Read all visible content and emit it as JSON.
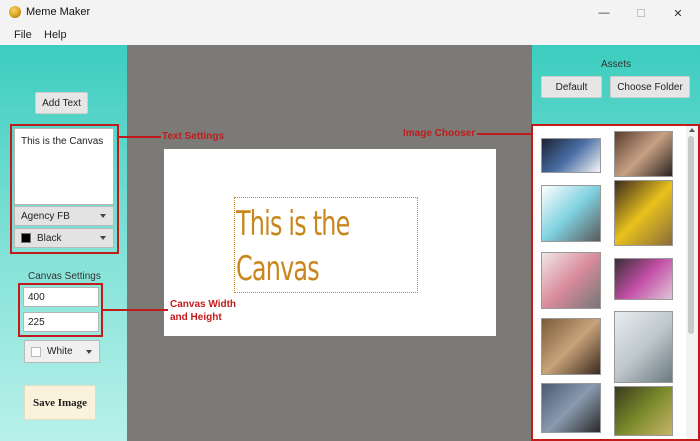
{
  "window": {
    "title": "Meme Maker",
    "minimize_glyph": "—",
    "maximize_glyph": "☐",
    "close_glyph": "✕"
  },
  "menu": {
    "items": [
      {
        "label": "File"
      },
      {
        "label": "Help"
      }
    ]
  },
  "left": {
    "add_text_label": "Add Text",
    "text_content": "This is the Canvas",
    "font_value": "Agency FB",
    "color_value": "Black",
    "color_swatch": "#000000",
    "canvas_settings_label": "Canvas Settings",
    "width_value": "400",
    "height_value": "225",
    "bg_value": "White",
    "bg_swatch": "#ffffff",
    "save_label": "Save Image"
  },
  "canvas": {
    "text_line1": "This is the",
    "text_line2": "Canvas",
    "text_color": "#c8861c"
  },
  "annotations": {
    "text_settings": "Text Settings",
    "image_chooser": "Image Chooser",
    "canvas_wh_line1": "Canvas Width",
    "canvas_wh_line2": "and Height"
  },
  "right": {
    "assets_label": "Assets",
    "default_label": "Default",
    "choose_folder_label": "Choose Folder"
  },
  "thumbnails": [
    {
      "name": "thumb-earth-meme",
      "colors": [
        "#1c2336",
        "#4a6fa5",
        "#f5f5f5"
      ]
    },
    {
      "name": "thumb-man-face",
      "colors": [
        "#5a3d2e",
        "#c7a184",
        "#2c2420"
      ]
    },
    {
      "name": "thumb-pink-characters",
      "colors": [
        "#ffffff",
        "#7fd1e0",
        "#5a5a5a"
      ]
    },
    {
      "name": "thumb-man-yellow-shirt",
      "colors": [
        "#3b2a1f",
        "#e8c11c",
        "#8a6b3a"
      ]
    },
    {
      "name": "thumb-comic-strip",
      "colors": [
        "#f0e6e6",
        "#d98b9b",
        "#777777"
      ]
    },
    {
      "name": "thumb-pink-figure",
      "colors": [
        "#3a2f35",
        "#c24ea6",
        "#e0c6d8"
      ]
    },
    {
      "name": "thumb-cats-grid",
      "colors": [
        "#7a5b3a",
        "#c9a37a",
        "#3a2a1e"
      ]
    },
    {
      "name": "thumb-robot-machine",
      "colors": [
        "#e8eef0",
        "#bfc8cc",
        "#6b7a80"
      ]
    },
    {
      "name": "thumb-crowd-scene",
      "colors": [
        "#4a5a70",
        "#8a9bb0",
        "#2a2a2a"
      ]
    },
    {
      "name": "thumb-shrek-face",
      "colors": [
        "#3a3a1e",
        "#7a8a2a",
        "#c8b46a"
      ]
    }
  ]
}
